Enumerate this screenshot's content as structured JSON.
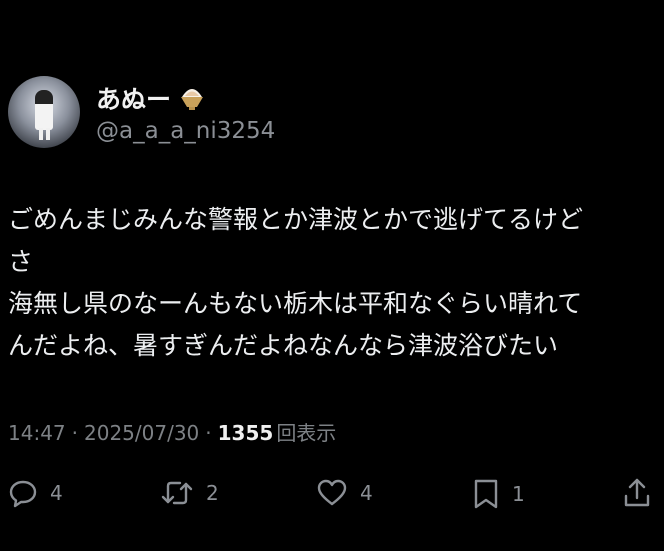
{
  "user": {
    "display_name": "あぬー",
    "handle": "@a_a_a_ni3254",
    "badge_icon": "shaved-ice-emoji"
  },
  "tweet": {
    "lines": [
      "ごめんまじみんな警報とか津波とかで逃げてるけど",
      "さ",
      "海無し県のなーんもない栃木は平和なぐらい晴れて",
      "んだよね、暑すぎんだよねなんなら津波浴びたい"
    ]
  },
  "meta": {
    "time": "14:47",
    "sep1": "·",
    "date": "2025/07/30",
    "sep2": "·",
    "views": "1355",
    "views_label": "回表示"
  },
  "actions": {
    "reply_count": "4",
    "retweet_count": "2",
    "like_count": "4",
    "bookmark_count": "1",
    "icons": [
      "reply-icon",
      "retweet-icon",
      "like-icon",
      "bookmark-icon",
      "share-icon"
    ]
  },
  "colors": {
    "background": "#000000",
    "text": "#e7e9ea",
    "muted": "#8b8f95"
  }
}
